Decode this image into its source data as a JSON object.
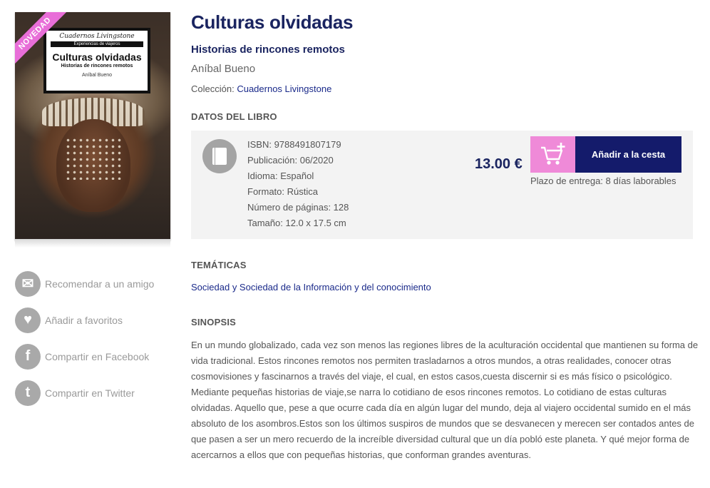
{
  "cover": {
    "ribbon": "NOVEDAD",
    "series": "Cuadernos Livingstone",
    "series_sub": "Experiencias de viajeros",
    "title": "Culturas olvidadas",
    "subtitle": "Historias de rincones remotos",
    "author": "Aníbal Bueno"
  },
  "actions": [
    {
      "icon": "envelope-icon",
      "glyph": "✉",
      "label": "Recomendar a un amigo"
    },
    {
      "icon": "heart-icon",
      "glyph": "♥",
      "label": "Añadir a favoritos"
    },
    {
      "icon": "facebook-icon",
      "glyph": "f",
      "label": "Compartir en Facebook"
    },
    {
      "icon": "twitter-icon",
      "glyph": "t",
      "label": "Compartir en Twitter"
    }
  ],
  "book": {
    "title": "Culturas olvidadas",
    "subtitle": "Historias de rincones remotos",
    "author": "Aníbal Bueno",
    "collection_label": "Colección:",
    "collection": "Cuadernos Livingstone"
  },
  "datos": {
    "heading": "DATOS DEL LIBRO",
    "specs": [
      "ISBN: 9788491807179",
      "Publicación: 06/2020",
      "Idioma: Español",
      "Formato: Rústica",
      "Número de páginas: 128",
      "Tamaño: 12.0 x 17.5 cm"
    ],
    "price": "13.00 €",
    "cart_label": "Añadir a la cesta",
    "delivery": "Plazo de entrega: 8 días laborables"
  },
  "tematicas": {
    "heading": "TEMÁTICAS",
    "link": "Sociedad y Sociedad de la Información y del conocimiento"
  },
  "sinopsis": {
    "heading": "SINOPSIS",
    "text": "En un mundo globalizado, cada vez son menos las regiones libres de la aculturación occidental que mantienen su forma de vida tradicional. Estos rincones remotos nos permiten trasladarnos a otros mundos, a otras realidades, conocer otras cosmovisiones y fascinarnos a través del viaje, el cual, en estos casos,cuesta discernir si es más físico o psicológico. Mediante pequeñas historias de viaje,se narra lo cotidiano de esos rincones remotos. Lo cotidiano de estas culturas olvidadas. Aquello que, pese a que ocurre cada día en algún lugar del mundo, deja al viajero occidental sumido en el más absoluto de los asombros.Estos son los últimos suspiros de mundos que se desvanecen y merecen ser contados antes de que pasen a ser un mero recuerdo de la increíble diversidad cultural que un día pobló este planeta. Y qué mejor forma de acercarnos a ellos que con pequeñas historias, que conforman grandes aventuras."
  },
  "colors": {
    "navy": "#1a2460",
    "pink": "#ef8ad8",
    "button": "#141b6b",
    "icon_gray": "#a9a9a9"
  }
}
